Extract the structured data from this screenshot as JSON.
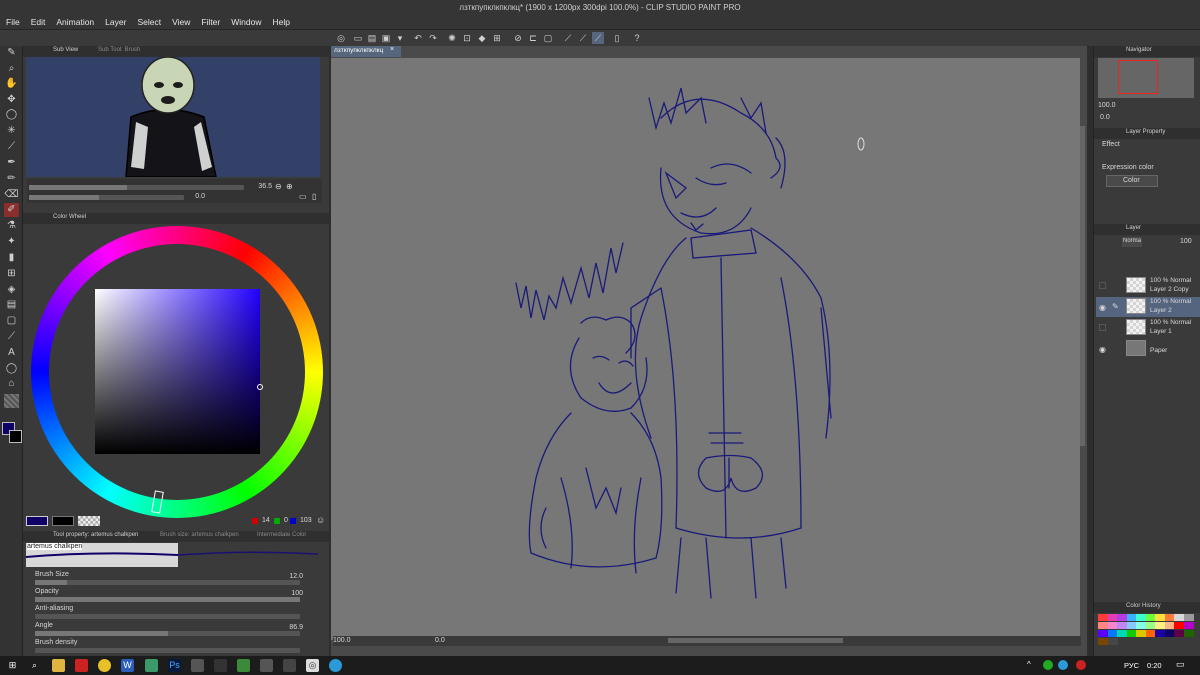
{
  "window": {
    "title": "лзткпупклкпклкц* (1900 x 1200px 300dpi 100.0%) - CLIP STUDIO PAINT PRO"
  },
  "menu": [
    "File",
    "Edit",
    "Animation",
    "Layer",
    "Select",
    "View",
    "Filter",
    "Window",
    "Help"
  ],
  "tabs": {
    "sub_view": "Sub View",
    "sub_tool": "Sub Tool: Brush",
    "color_wheel": "Color Wheel",
    "tool_property": "Tool property: artemus chalkpen",
    "brush_size_tab": "Brush size: artemus chalkpen",
    "intermediate_color": "Intermediate Color",
    "canvas_tab": "лзткпупклкпклкц",
    "navigator": "Navigator",
    "layer_property": "Layer Property",
    "layer": "Layer",
    "color_history": "Color History"
  },
  "subview": {
    "zoom": "36.5",
    "rotation": "0.0"
  },
  "color": {
    "r": "14",
    "g": "0",
    "b": "103",
    "main_hex": "#0e0067"
  },
  "brush": {
    "name": "artemus chalkpen",
    "props": [
      {
        "label": "Brush Size",
        "value": "12.0",
        "fill": 0.12
      },
      {
        "label": "Opacity",
        "value": "100",
        "fill": 1.0
      },
      {
        "label": "Anti-aliasing",
        "value": "",
        "fill": 0
      },
      {
        "label": "Angle",
        "value": "86.9",
        "fill": 0.5
      },
      {
        "label": "Brush density",
        "value": "",
        "fill": 0
      }
    ]
  },
  "canvas_status": {
    "zoom": "100.0",
    "rotation": "0.0"
  },
  "navigator": {
    "zoom": "100.0",
    "rotation": "0.0"
  },
  "layer_property": {
    "effect_label": "Effect",
    "expression_label": "Expression color",
    "expression_value": "Color"
  },
  "layer_panel": {
    "blend": "Normal",
    "opacity": "100",
    "layers": [
      {
        "line1": "100 % Normal",
        "line2": "Layer 2 Copy",
        "visible": false,
        "selected": false
      },
      {
        "line1": "100 % Normal",
        "line2": "Layer 2",
        "visible": true,
        "selected": true
      },
      {
        "line1": "100 % Normal",
        "line2": "Layer 1",
        "visible": false,
        "selected": false
      },
      {
        "line1": "",
        "line2": "Paper",
        "visible": true,
        "selected": false
      }
    ]
  },
  "color_history_colors": [
    "#ff3b3b",
    "#e53bb4",
    "#b53be5",
    "#3bb0ff",
    "#3bffcf",
    "#6bff3b",
    "#ffe03b",
    "#ff7a3b",
    "#d8d8d8",
    "#9a9a9a",
    "#ff8585",
    "#f685d0",
    "#c185f6",
    "#85c9ff",
    "#85ffe3",
    "#9cff85",
    "#fff085",
    "#ffb585",
    "#ff0000",
    "#b400c8",
    "#5a00ff",
    "#0078ff",
    "#00d8b4",
    "#14c800",
    "#d8c800",
    "#ff6400",
    "#1c00a0",
    "#0e0067",
    "#5b0046",
    "#1e6400",
    "#784600",
    "#464646"
  ],
  "taskbar": {
    "lang": "РУС",
    "time": "0:20"
  }
}
